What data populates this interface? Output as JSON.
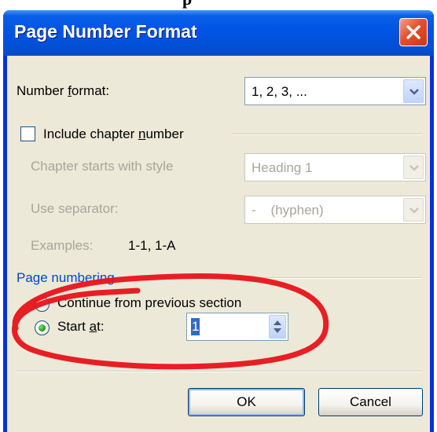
{
  "page_heading_fragment": "p",
  "dialog": {
    "title": "Page Number Format"
  },
  "number_format": {
    "label_prefix": "Number ",
    "label_accel": "f",
    "label_suffix": "ormat:",
    "value": "1, 2, 3, ..."
  },
  "chapter": {
    "include_label_prefix": "Include chapter ",
    "include_label_accel": "n",
    "include_label_suffix": "umber",
    "include_checked": false,
    "starts_with_label": "Chapter starts with style",
    "starts_with_value": "Heading 1",
    "separator_label": "Use separator:",
    "separator_value": "-    (hyphen)",
    "examples_label": "Examples:",
    "examples_value": "1-1, 1-A"
  },
  "page_numbering": {
    "group_label": "Page numbering",
    "continue_label": "Continue from previous section",
    "continue_selected": false,
    "start_at_label_prefix": "Start ",
    "start_at_label_accel": "a",
    "start_at_label_suffix": "t:",
    "start_at_selected": true,
    "start_at_value": "1"
  },
  "buttons": {
    "ok": "OK",
    "cancel": "Cancel"
  },
  "colors": {
    "titlebar": "#0055e5",
    "dialog_face": "#ece9d8",
    "annotation": "#e8131b",
    "selection": "#316ac5"
  },
  "icons": {
    "close": "close-icon",
    "dropdown": "chevron-down-icon",
    "spinner": "spinner-arrows-icon"
  }
}
